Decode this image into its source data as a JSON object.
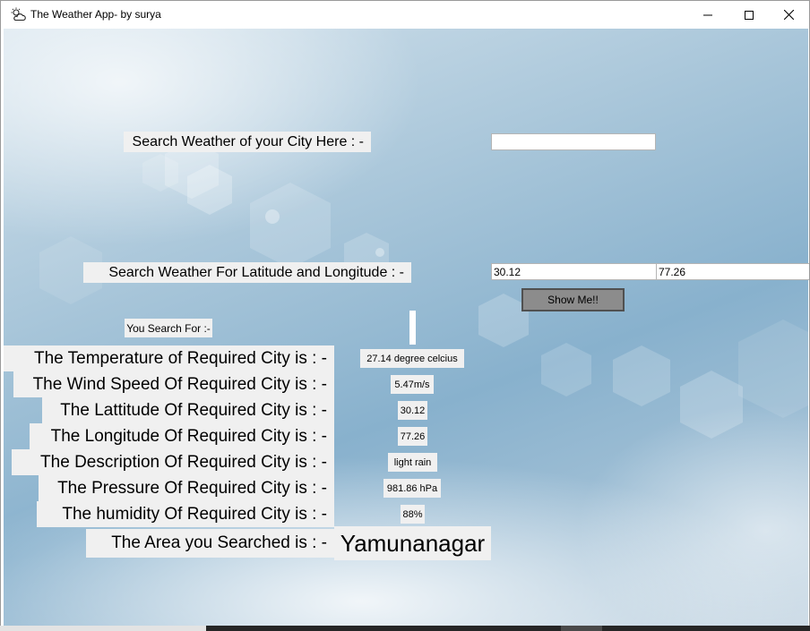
{
  "window": {
    "title": "The Weather App- by surya",
    "app_icon": "partly-cloudy-icon",
    "controls": [
      "minimize-icon",
      "maximize-icon",
      "close-icon"
    ]
  },
  "search": {
    "city_label": "Search Weather of your City Here : -",
    "city_value": "",
    "latlon_label": "Search Weather For Latitude and Longitude : -",
    "latitude_value": "30.12",
    "longitude_value": "77.26",
    "button_label": "Show Me!!"
  },
  "results": {
    "you_search_for_label": "You Search For :-",
    "you_search_for_value": "",
    "rows": [
      {
        "label": "The Temperature of Required City is : -",
        "value": "27.14  degree celcius"
      },
      {
        "label": "The Wind Speed Of Required City is : -",
        "value": "5.47m/s"
      },
      {
        "label": "The Lattitude Of Required City is : -",
        "value": "30.12"
      },
      {
        "label": "The Longitude Of Required City is : -",
        "value": "77.26"
      },
      {
        "label": "The Description Of Required City is : -",
        "value": "light rain"
      },
      {
        "label": "The Pressure Of Required City is : -",
        "value": "981.86 hPa"
      },
      {
        "label": "The humidity Of Required City is : -",
        "value": "88%"
      }
    ],
    "area_label": "The Area you Searched is : -",
    "area_value": "Yamunanagar"
  },
  "colors": {
    "label_bg": "#f0f0f0",
    "button_bg": "#8c8c8c",
    "sky": "#88b1cd"
  }
}
